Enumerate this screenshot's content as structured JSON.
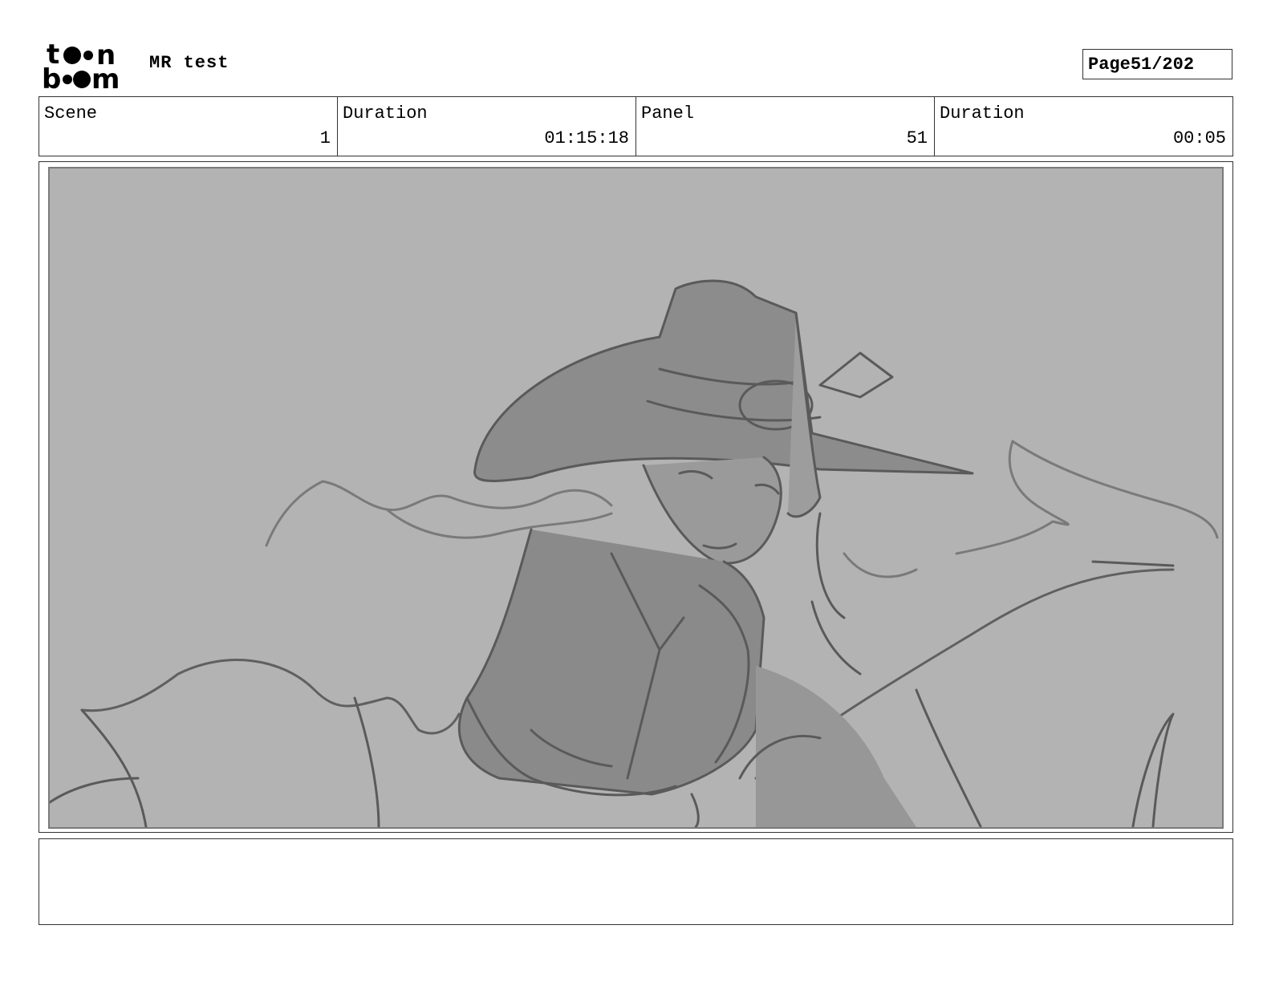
{
  "header": {
    "logo_text": "toon boom",
    "project_title": "MR test",
    "page_label": "Page",
    "page_number": "51/202"
  },
  "info": [
    {
      "label": "Scene",
      "value": "1"
    },
    {
      "label": "Duration",
      "value": "01:15:18"
    },
    {
      "label": "Panel",
      "value": "51"
    },
    {
      "label": "Duration",
      "value": "00:05"
    }
  ],
  "panel": {
    "background_color": "#b3b3b3",
    "sketch_description_icon": "sketch-drawing"
  },
  "notes": {
    "text": ""
  }
}
